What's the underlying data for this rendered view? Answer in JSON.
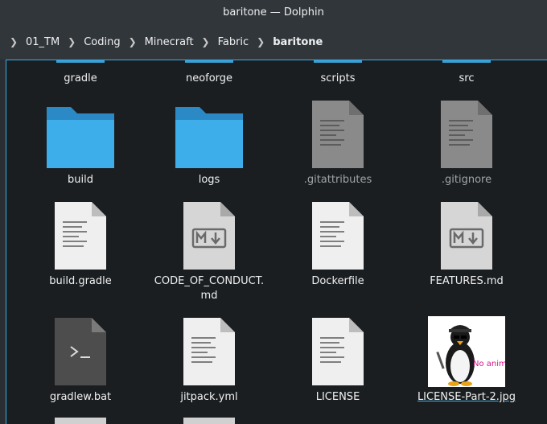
{
  "window": {
    "title": "baritone — Dolphin"
  },
  "breadcrumb": [
    "01_TM",
    "Coding",
    "Minecraft",
    "Fabric",
    "baritone"
  ],
  "files": [
    {
      "name": "gradle",
      "kind": "folder"
    },
    {
      "name": "neoforge",
      "kind": "folder"
    },
    {
      "name": "scripts",
      "kind": "folder"
    },
    {
      "name": "src",
      "kind": "folder"
    },
    {
      "name": "build",
      "kind": "folder"
    },
    {
      "name": "logs",
      "kind": "folder"
    },
    {
      "name": ".gitattributes",
      "kind": "text-hidden"
    },
    {
      "name": ".gitignore",
      "kind": "text-hidden"
    },
    {
      "name": "build.gradle",
      "kind": "text"
    },
    {
      "name": "CODE_OF_CONDUCT.",
      "name2": "md",
      "kind": "markdown"
    },
    {
      "name": "Dockerfile",
      "kind": "text"
    },
    {
      "name": "FEATURES.md",
      "kind": "markdown"
    },
    {
      "name": "gradlew.bat",
      "kind": "script"
    },
    {
      "name": "jitpack.yml",
      "kind": "text"
    },
    {
      "name": "LICENSE",
      "kind": "text"
    },
    {
      "name": "LICENSE-Part-2.jpg",
      "kind": "image",
      "image_text": "No anime"
    }
  ],
  "colors": {
    "accent": "#3daee9",
    "folder": "#3daee9"
  }
}
